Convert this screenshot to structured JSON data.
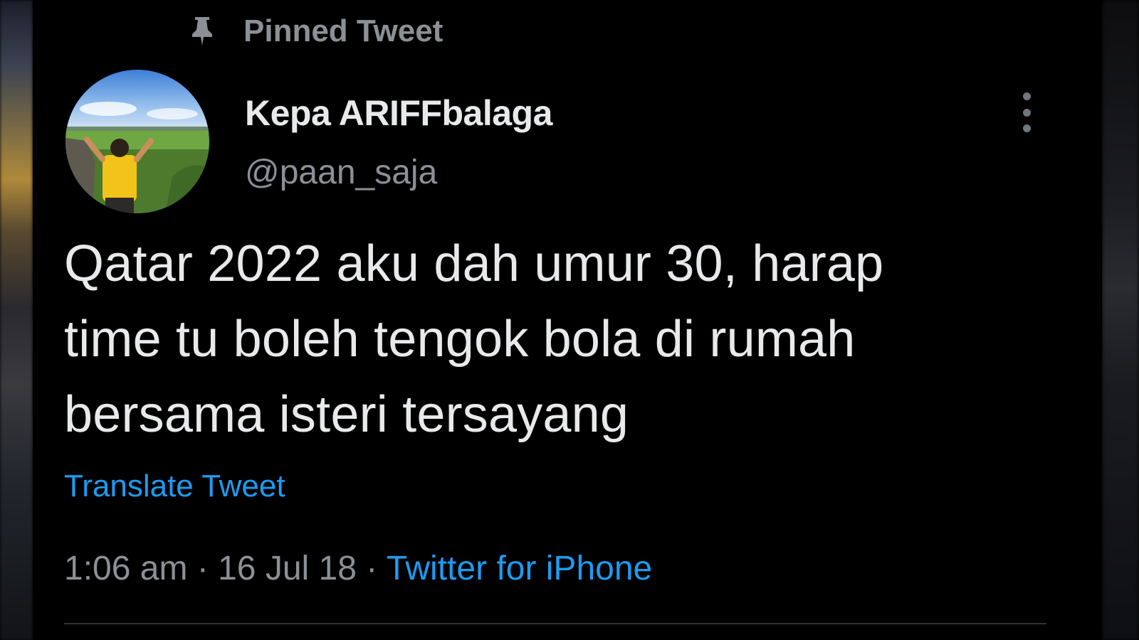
{
  "pinned": {
    "label": "Pinned Tweet",
    "icon": "pin-icon"
  },
  "author": {
    "display_name": "Kepa ARIFFbalaga",
    "handle": "@paan_saja",
    "avatar_icon": "avatar-photo"
  },
  "more_icon": "more-options-icon",
  "tweet": {
    "lines": [
      "Qatar 2022 aku dah umur 30, harap",
      "time tu boleh tengok bola di rumah",
      "bersama isteri tersayang"
    ],
    "translate_label": "Translate Tweet",
    "time": "1:06 am",
    "separator": "·",
    "date": "16 Jul 18",
    "source": "Twitter for iPhone"
  },
  "colors": {
    "background": "#000000",
    "primary_text": "#e7e9ea",
    "secondary_text": "#8b9096",
    "link": "#1d9bf0",
    "divider": "#2f3336"
  }
}
